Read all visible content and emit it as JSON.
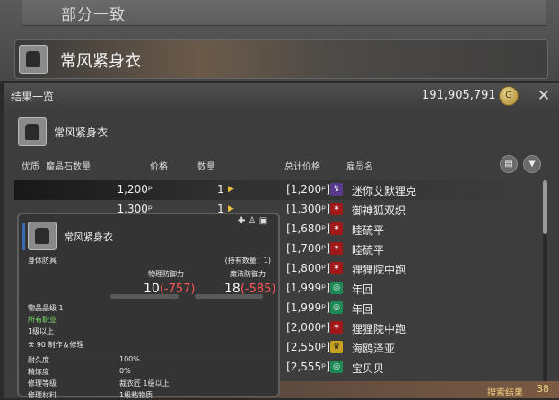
{
  "search": {
    "header": "部分一致",
    "item_name": "常风紧身衣"
  },
  "results": {
    "title": "结果一览",
    "gil": "191,905,791",
    "selected_item": "常风紧身衣",
    "columns": {
      "hq": "优质",
      "materia": "魔晶石数量",
      "price": "价格",
      "qty": "数量",
      "total": "总计价格",
      "retainer": "雇员名"
    },
    "rows": [
      {
        "price": "1,200ᵖ",
        "qty": "1",
        "total": "[1,200ᵖ]",
        "retainer": "迷你艾默狸克",
        "city_color": "purple",
        "city": "↯"
      },
      {
        "price": "1,300ᵖ",
        "qty": "1",
        "total": "[1,300ᵖ]",
        "retainer": "御神狐双织",
        "city_color": "red",
        "city": "✶"
      },
      {
        "price": "",
        "qty": "",
        "total": "[1,680ᵖ]",
        "retainer": "睦硫平",
        "city_color": "red",
        "city": "✶"
      },
      {
        "price": "",
        "qty": "",
        "total": "[1,700ᵖ]",
        "retainer": "睦硫平",
        "city_color": "red",
        "city": "✶"
      },
      {
        "price": "",
        "qty": "",
        "total": "[1,800ᵖ]",
        "retainer": "狸狸院中跑",
        "city_color": "red",
        "city": "✶"
      },
      {
        "price": "",
        "qty": "",
        "total": "[1,999ᵖ]",
        "retainer": "年回",
        "city_color": "green",
        "city": "◎"
      },
      {
        "price": "",
        "qty": "",
        "total": "[1,999ᵖ]",
        "retainer": "年回",
        "city_color": "green",
        "city": "◎"
      },
      {
        "price": "",
        "qty": "",
        "total": "[2,000ᵖ]",
        "retainer": "狸狸院中跑",
        "city_color": "red",
        "city": "✶"
      },
      {
        "price": "",
        "qty": "",
        "total": "[2,550ᵖ]",
        "retainer": "海鸥泽亚",
        "city_color": "yellow",
        "city": "♛"
      },
      {
        "price": "",
        "qty": "",
        "total": "[2,555ᵖ]",
        "retainer": "宝贝贝",
        "city_color": "green",
        "city": "◎"
      }
    ],
    "count_label": "搜索结果",
    "count": "38"
  },
  "tooltip": {
    "name": "常风紧身衣",
    "type": "身体防具",
    "held": "(持有数量：1)",
    "phys_label": "物理防御力",
    "phys_value": "10",
    "phys_diff": "(-757)",
    "mag_label": "魔法防御力",
    "mag_value": "18",
    "mag_diff": "(-585)",
    "ilvl": "物品品级 1",
    "classes": "所有职业",
    "level": "1级以上",
    "craft": "90 制作＆修理",
    "stats": [
      {
        "k": "耐久度",
        "v": "100%"
      },
      {
        "k": "精炼度",
        "v": "0%"
      },
      {
        "k": "修理等级",
        "v": "裁衣匠 1级以上"
      },
      {
        "k": "修理材料",
        "v": "1级粘物质"
      }
    ]
  },
  "icons": {
    "gil": "gil-coin-icon",
    "close": "close-icon",
    "item": "body-armor-icon"
  }
}
